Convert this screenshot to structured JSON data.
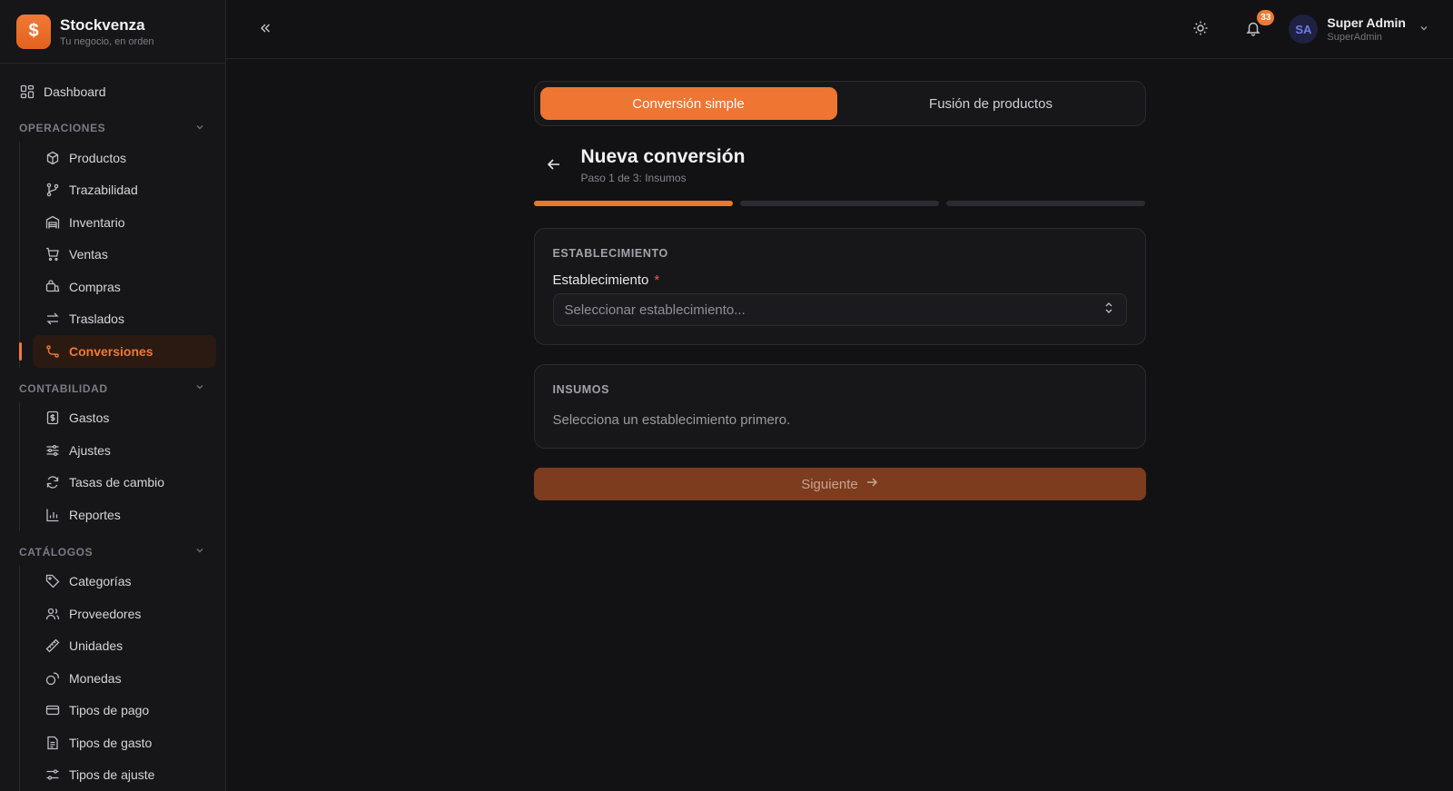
{
  "brand": {
    "name": "Stockvenza",
    "tagline": "Tu negocio, en orden",
    "logo_icon": "dollar-icon"
  },
  "sidebar": {
    "dashboard": "Dashboard",
    "sections": [
      {
        "title": "OPERACIONES",
        "items": [
          {
            "label": "Productos",
            "icon": "package-icon"
          },
          {
            "label": "Trazabilidad",
            "icon": "git-branch-icon"
          },
          {
            "label": "Inventario",
            "icon": "warehouse-icon"
          },
          {
            "label": "Ventas",
            "icon": "cart-icon"
          },
          {
            "label": "Compras",
            "icon": "shopping-bag-icon"
          },
          {
            "label": "Traslados",
            "icon": "arrows-left-right-icon"
          },
          {
            "label": "Conversiones",
            "icon": "route-icon",
            "active": true
          }
        ]
      },
      {
        "title": "CONTABILIDAD",
        "items": [
          {
            "label": "Gastos",
            "icon": "receipt-icon"
          },
          {
            "label": "Ajustes",
            "icon": "sliders-icon"
          },
          {
            "label": "Tasas de cambio",
            "icon": "refresh-icon"
          },
          {
            "label": "Reportes",
            "icon": "bar-chart-icon"
          }
        ]
      },
      {
        "title": "CATÁLOGOS",
        "items": [
          {
            "label": "Categorías",
            "icon": "tag-icon"
          },
          {
            "label": "Proveedores",
            "icon": "users-icon"
          },
          {
            "label": "Unidades",
            "icon": "ruler-icon"
          },
          {
            "label": "Monedas",
            "icon": "coins-icon"
          },
          {
            "label": "Tipos de pago",
            "icon": "credit-card-icon"
          },
          {
            "label": "Tipos de gasto",
            "icon": "file-text-icon"
          },
          {
            "label": "Tipos de ajuste",
            "icon": "sliders-alt-icon"
          }
        ]
      }
    ]
  },
  "topbar": {
    "notifications_count": "33",
    "user": {
      "initials": "SA",
      "name": "Super Admin",
      "role": "SuperAdmin"
    }
  },
  "tabs": [
    {
      "label": "Conversión simple",
      "active": true
    },
    {
      "label": "Fusión de productos",
      "active": false
    }
  ],
  "page": {
    "title": "Nueva conversión",
    "subtitle": "Paso 1 de 3: Insumos",
    "steps_total": 3,
    "steps_completed": 1
  },
  "establishment_card": {
    "title": "ESTABLECIMIENTO",
    "field_label": "Establecimiento",
    "required_mark": "*",
    "placeholder": "Seleccionar establecimiento..."
  },
  "inputs_card": {
    "title": "INSUMOS",
    "hint": "Selecciona un establecimiento primero."
  },
  "next_button": {
    "label": "Siguiente"
  },
  "colors": {
    "accent": "#ee7532",
    "background": "#121215",
    "surface": "#17171a"
  }
}
